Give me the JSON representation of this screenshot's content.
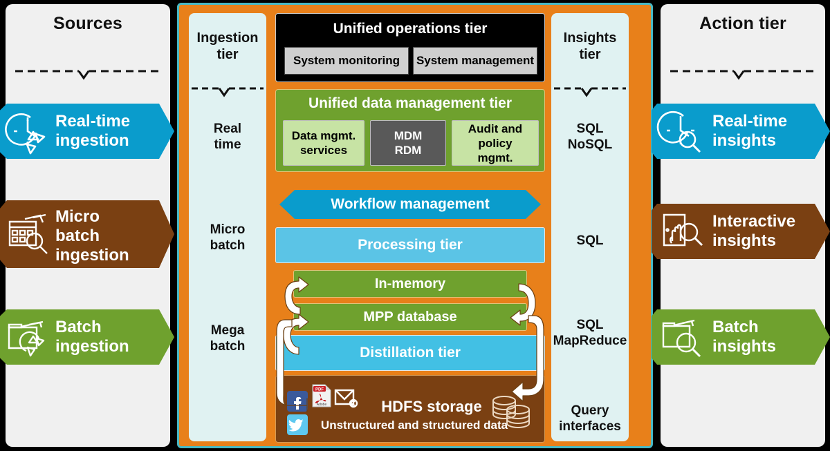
{
  "diagram": {
    "colors": {
      "orange": "#e8801a",
      "teal_border": "#49b8c4",
      "panel_gray": "#f0f0f0",
      "tier_panel": "#e0f2f2",
      "blue": "#0a9ccc",
      "light_blue": "#5bc4e6",
      "cyan": "#42c0e4",
      "green": "#6fa12e",
      "light_green": "#c7e3a4",
      "brown": "#7a4012",
      "black": "#000000",
      "gray": "#595959"
    }
  },
  "sources": {
    "title": "Sources",
    "items": [
      {
        "label": "Real-time\ningestion",
        "line1": "Real-time",
        "line2": "ingestion",
        "color": "#0a9ccc",
        "icon": "clock-recycle-icon"
      },
      {
        "label": "Micro batch ingestion",
        "line1": "Micro",
        "line2": "batch",
        "line3": "ingestion",
        "color": "#7a4012",
        "icon": "calendar-search-icon"
      },
      {
        "label": "Batch ingestion",
        "line1": "Batch",
        "line2": "ingestion",
        "color": "#6fa12e",
        "icon": "folder-recycle-icon"
      }
    ]
  },
  "ingestion_tier": {
    "title_line1": "Ingestion",
    "title_line2": "tier",
    "labels": [
      {
        "line1": "Real",
        "line2": "time"
      },
      {
        "line1": "Micro",
        "line2": "batch"
      },
      {
        "line1": "Mega",
        "line2": "batch"
      }
    ]
  },
  "operations_tier": {
    "title": "Unified operations tier",
    "sub_boxes": [
      {
        "label": "System monitoring"
      },
      {
        "label": "System management"
      }
    ]
  },
  "data_management_tier": {
    "title": "Unified data management tier",
    "sub_boxes": [
      {
        "line1": "Data mgmt.",
        "line2": "services",
        "style": "light"
      },
      {
        "line1": "MDM",
        "line2": "RDM",
        "style": "dark"
      },
      {
        "line1": "Audit and",
        "line2": "policy",
        "line3": "mgmt.",
        "style": "light"
      }
    ]
  },
  "center_stack": {
    "workflow": "Workflow management",
    "processing": "Processing tier",
    "in_memory": "In-memory",
    "mpp": "MPP database",
    "distillation": "Distillation tier",
    "hdfs_title": "HDFS storage",
    "hdfs_subtitle": "Unstructured and structured data",
    "hdfs_icons": [
      "facebook-icon",
      "pdf-icon",
      "email-icon",
      "twitter-icon",
      "database-stack-icon"
    ]
  },
  "insights_tier": {
    "title_line1": "Insights",
    "title_line2": "tier",
    "labels": [
      {
        "line1": "SQL",
        "line2": "NoSQL"
      },
      {
        "line1": "SQL",
        "line2": ""
      },
      {
        "line1": "SQL",
        "line2": "MapReduce"
      },
      {
        "line1": "Query",
        "line2": "interfaces"
      }
    ]
  },
  "action_tier": {
    "title": "Action tier",
    "items": [
      {
        "line1": "Real-time",
        "line2": "insights",
        "color": "#0a9ccc",
        "icon": "clock-search-icon"
      },
      {
        "line1": "Interactive",
        "line2": "insights",
        "color": "#7a4012",
        "icon": "tablet-touch-search-icon"
      },
      {
        "line1": "Batch",
        "line2": "insights",
        "color": "#6fa12e",
        "icon": "folder-search-icon"
      }
    ]
  }
}
